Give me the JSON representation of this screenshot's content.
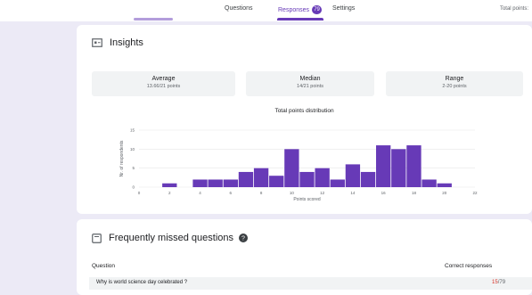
{
  "tabs": [
    {
      "label": "Questions"
    },
    {
      "label": "Responses",
      "badge": "79"
    },
    {
      "label": "Settings"
    }
  ],
  "total_points": "Total points: ",
  "insights": {
    "title": "Insights",
    "stats": [
      {
        "label": "Average",
        "value": "13.66/21 points"
      },
      {
        "label": "Median",
        "value": "14/21 points"
      },
      {
        "label": "Range",
        "value": "2-20 points"
      }
    ]
  },
  "chart_data": {
    "type": "bar",
    "title": "Total points distribution",
    "xlabel": "Points scored",
    "ylabel": "Nr. of respondents",
    "x": [
      2,
      3,
      4,
      5,
      6,
      7,
      8,
      9,
      10,
      11,
      12,
      13,
      14,
      15,
      16,
      17,
      18,
      19,
      20
    ],
    "values": [
      1,
      0,
      2,
      2,
      2,
      4,
      5,
      3,
      10,
      4,
      5,
      2,
      6,
      4,
      11,
      10,
      11,
      2,
      1
    ],
    "xticks": [
      0,
      2,
      4,
      6,
      8,
      10,
      12,
      14,
      16,
      18,
      20,
      22
    ],
    "yticks": [
      0,
      5,
      10,
      15
    ],
    "xlim": [
      0,
      22
    ],
    "ylim": [
      0,
      15
    ],
    "bar_color": "#673ab7",
    "grid": true
  },
  "missed": {
    "title": "Frequently missed questions",
    "col_question": "Question",
    "col_correct": "Correct responses",
    "rows": [
      {
        "question": "Why is world science day celebrated ?",
        "correct": "15",
        "total": "/79"
      }
    ]
  },
  "colors": {
    "accent": "#673ab7",
    "background": "#eceaf6",
    "error": "#d93025"
  }
}
